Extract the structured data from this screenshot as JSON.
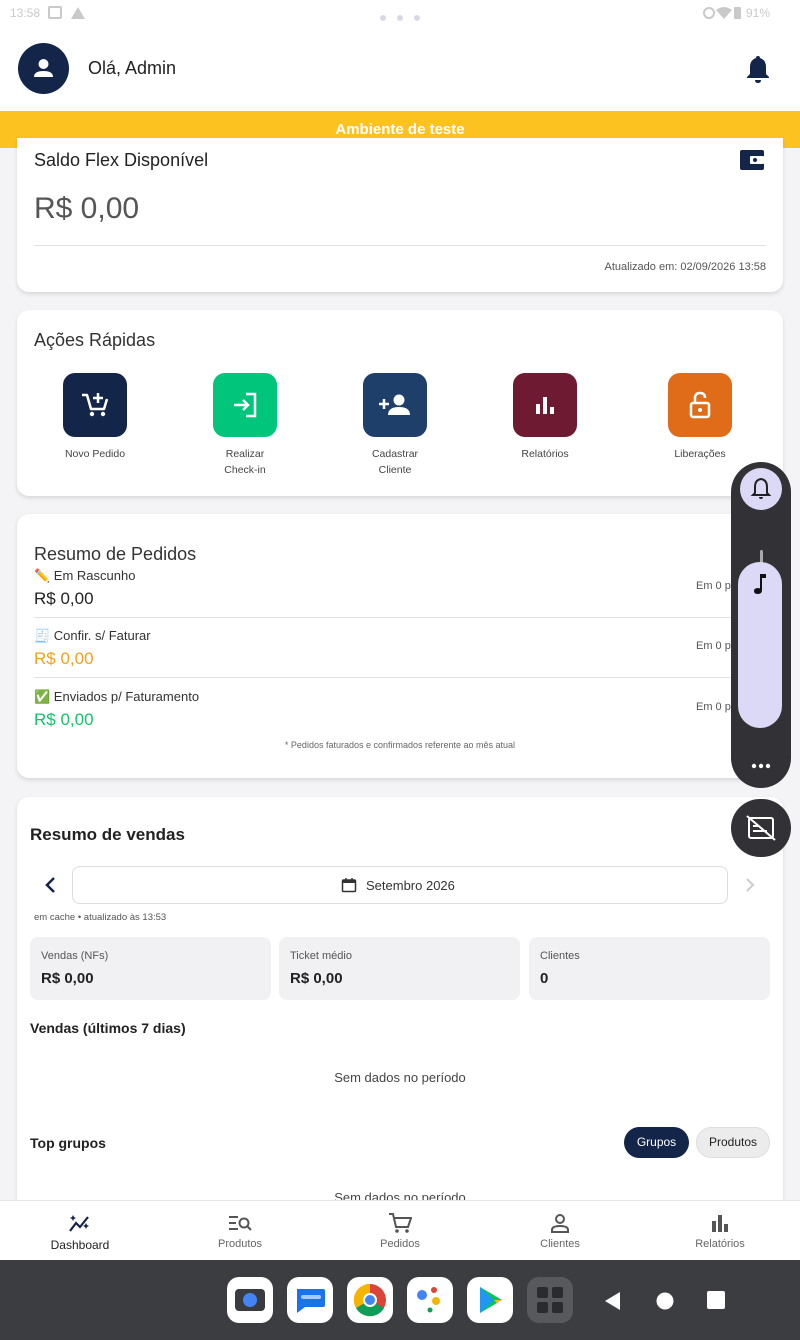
{
  "statusbar": {
    "time": "13:58",
    "battery": "91%"
  },
  "header": {
    "greeting": "Olá, Admin"
  },
  "banner": {
    "text": "Ambiente de teste"
  },
  "saldo": {
    "title": "Saldo Flex Disponível",
    "value": "R$ 0,00",
    "updated": "Atualizado em: 02/09/2026 13:58"
  },
  "acoes": {
    "title": "Ações Rápidas",
    "items": [
      {
        "label": "Novo Pedido",
        "color": "#14254a",
        "icon": "cart-add-icon"
      },
      {
        "label": "Realizar Check-in",
        "color": "#00c57a",
        "icon": "login-icon"
      },
      {
        "label": "Cadastrar Cliente",
        "color": "#1f3f6b",
        "icon": "person-add-icon"
      },
      {
        "label": "Relatórios",
        "color": "#6e1a32",
        "icon": "bar-chart-icon"
      },
      {
        "label": "Liberações",
        "color": "#e06c1a",
        "icon": "unlock-icon"
      }
    ]
  },
  "pedidos": {
    "title": "Resumo de Pedidos",
    "rows": [
      {
        "label": "✏️ Em Rascunho",
        "value": "R$ 0,00",
        "meta": "Em 0 p",
        "color": "#222222"
      },
      {
        "label": "🧾 Confir. s/ Faturar",
        "value": "R$ 0,00",
        "meta": "Em 0 p",
        "color": "#f0a21a"
      },
      {
        "label": "✅ Enviados p/ Faturamento",
        "value": "R$ 0,00",
        "meta": "Em 0 p",
        "color": "#12c46a"
      }
    ],
    "footnote": "* Pedidos faturados e confirmados referente ao mês atual"
  },
  "vendas": {
    "title": "Resumo de vendas",
    "month": "Setembro 2026",
    "cache": "em cache • atualizado às 13:53",
    "metrics": [
      {
        "label": "Vendas (NFs)",
        "value": "R$ 0,00"
      },
      {
        "label": "Ticket médio",
        "value": "R$ 0,00"
      },
      {
        "label": "Clientes",
        "value": "0"
      }
    ],
    "last7_title": "Vendas (últimos 7 dias)",
    "empty": "Sem dados no período",
    "top_title": "Top grupos",
    "chip_grupos": "Grupos",
    "chip_produtos": "Produtos"
  },
  "nav": [
    {
      "label": "Dashboard",
      "icon": "dashboard-icon",
      "active": true
    },
    {
      "label": "Produtos",
      "icon": "product-search-icon"
    },
    {
      "label": "Pedidos",
      "icon": "cart-icon"
    },
    {
      "label": "Clientes",
      "icon": "person-icon"
    },
    {
      "label": "Relatórios",
      "icon": "bar-chart-icon"
    }
  ]
}
